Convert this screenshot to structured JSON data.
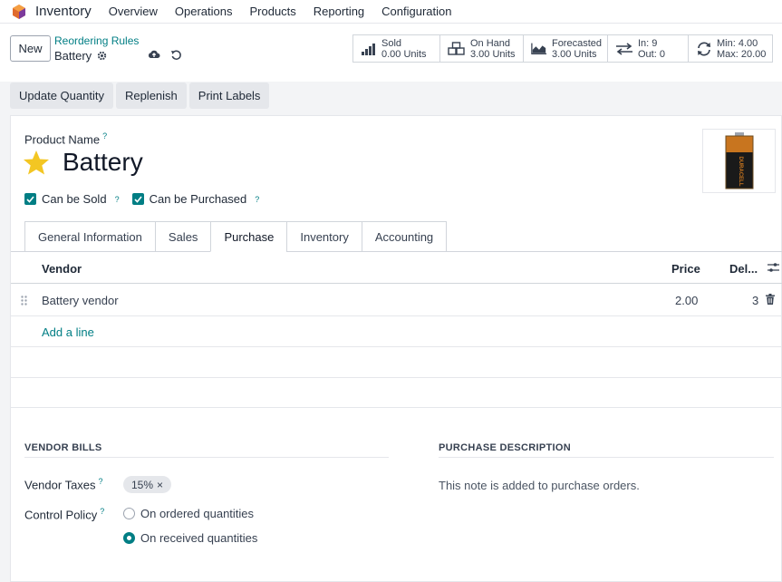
{
  "topnav": {
    "app_name": "Inventory",
    "items": [
      "Overview",
      "Operations",
      "Products",
      "Reporting",
      "Configuration"
    ]
  },
  "control_panel": {
    "new_label": "New",
    "breadcrumb": "Reordering Rules",
    "record_name": "Battery"
  },
  "smart_buttons": [
    {
      "label": "Sold",
      "value": "0.00 Units",
      "icon": "chart-bars-icon"
    },
    {
      "label": "On Hand",
      "value": "3.00 Units",
      "icon": "boxes-icon"
    },
    {
      "label": "Forecasted",
      "value": "3.00 Units",
      "icon": "area-chart-icon"
    },
    {
      "label": "In: 9",
      "value": "Out: 0",
      "icon": "transfer-arrows-icon"
    },
    {
      "label": "Min: 4.00",
      "value": "Max: 20.00",
      "icon": "refresh-icon"
    }
  ],
  "actions": [
    "Update Quantity",
    "Replenish",
    "Print Labels"
  ],
  "product": {
    "name_label": "Product Name",
    "name": "Battery",
    "can_be_sold": "Can be Sold",
    "can_be_purchased": "Can be Purchased",
    "help": "?",
    "image_brand": "DURACELL"
  },
  "tabs": [
    "General Information",
    "Sales",
    "Purchase",
    "Inventory",
    "Accounting"
  ],
  "active_tab": "Purchase",
  "vendor_grid": {
    "columns": {
      "vendor": "Vendor",
      "price": "Price",
      "delivery": "Del..."
    },
    "rows": [
      {
        "vendor": "Battery vendor",
        "price": "2.00",
        "delivery": "3"
      }
    ],
    "add_line": "Add a line"
  },
  "vendor_bills": {
    "title": "VENDOR BILLS",
    "taxes_label": "Vendor Taxes",
    "tax_tag": "15%",
    "tag_remove": "×",
    "control_policy_label": "Control Policy",
    "options": [
      "On ordered quantities",
      "On received quantities"
    ],
    "selected": "On received quantities"
  },
  "purchase_description": {
    "title": "PURCHASE DESCRIPTION",
    "note": "This note is added to purchase orders."
  },
  "colors": {
    "accent": "#017e84",
    "star": "#f3c623"
  }
}
